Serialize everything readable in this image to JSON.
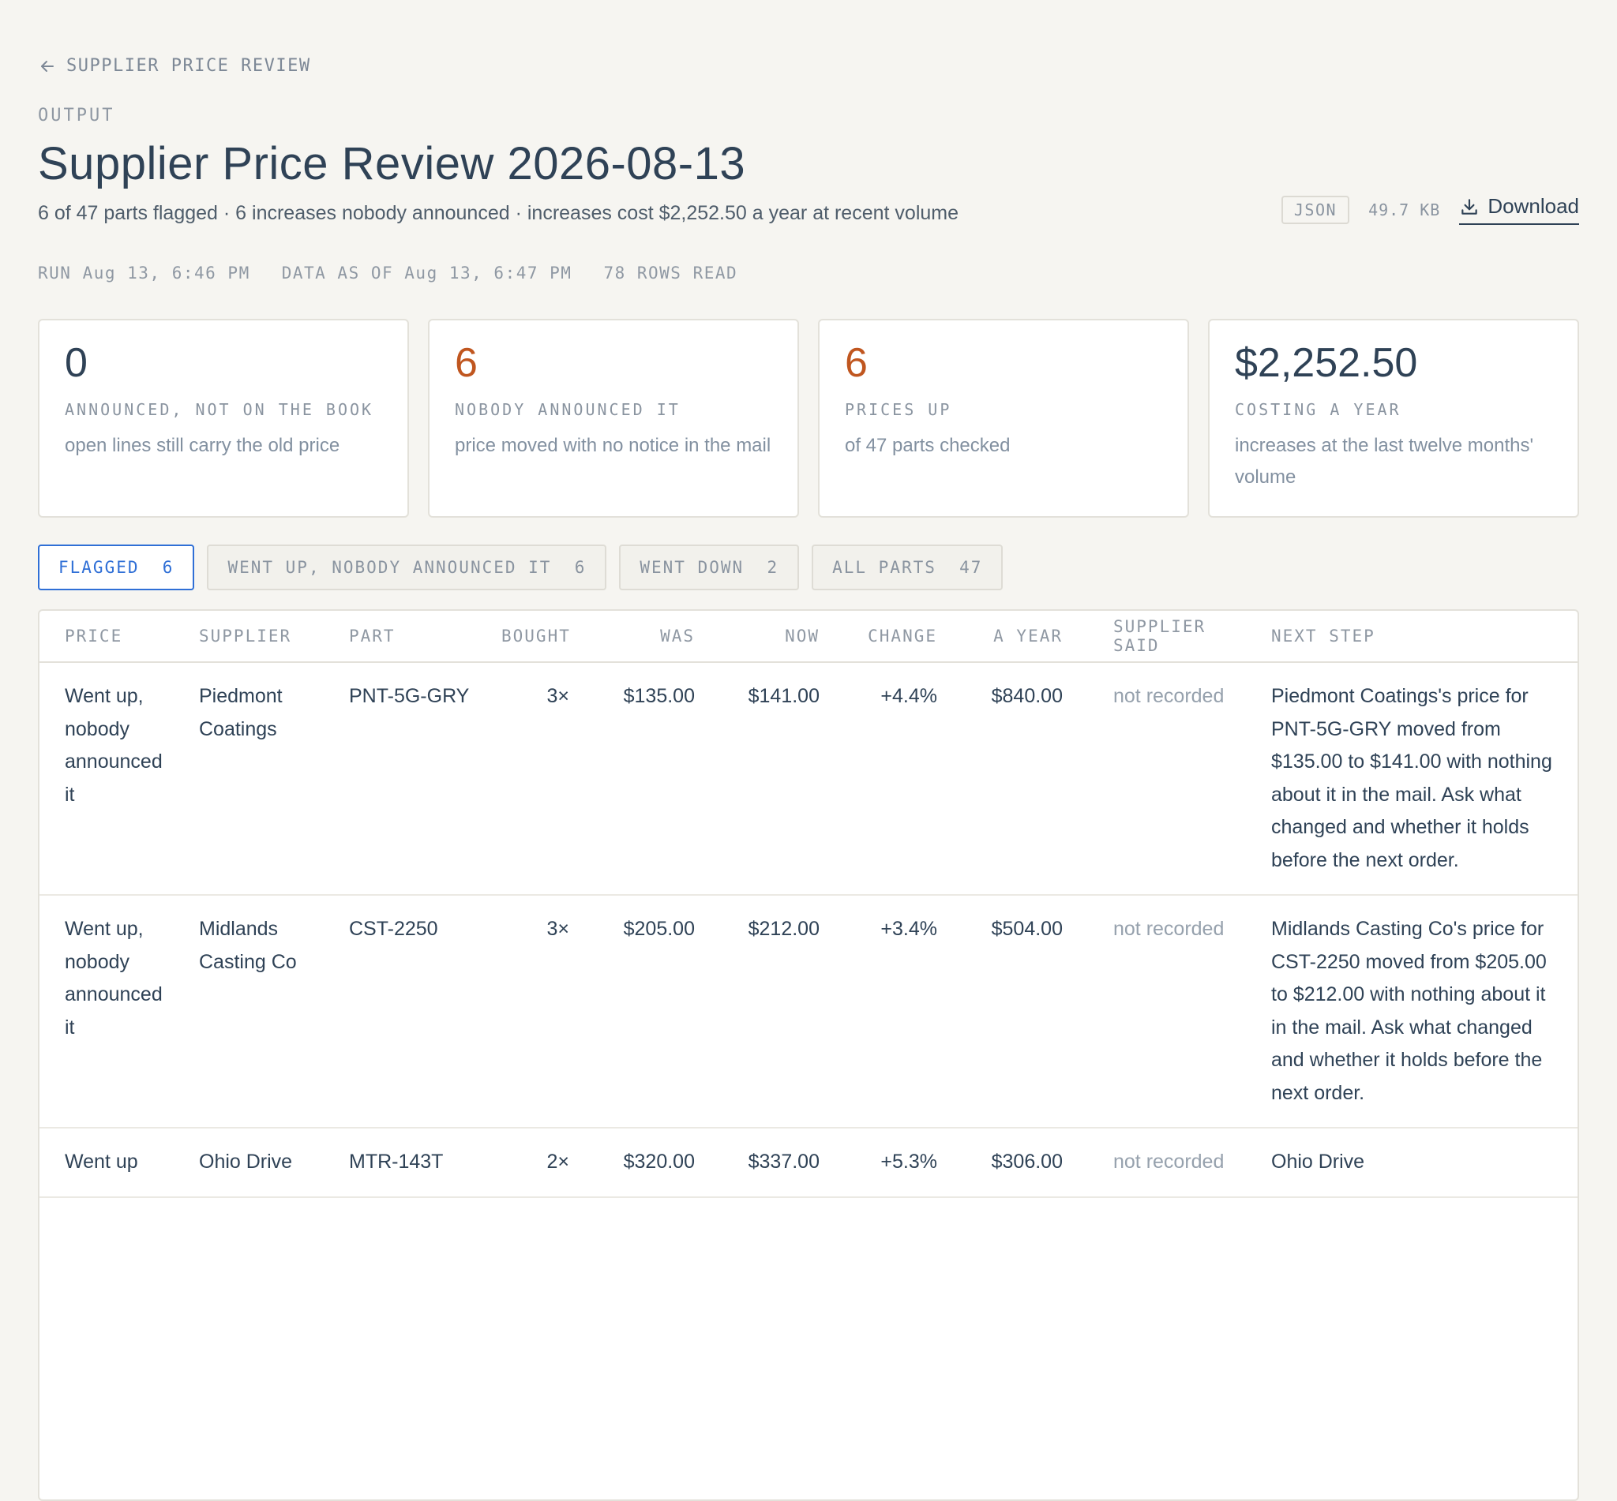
{
  "breadcrumb": {
    "label": "SUPPLIER PRICE REVIEW"
  },
  "page": {
    "eyebrow": "OUTPUT",
    "title": "Supplier Price Review 2026-08-13",
    "summary": "6 of 47 parts flagged · 6 increases nobody announced · increases cost $2,252.50 a year at recent volume"
  },
  "file": {
    "format": "JSON",
    "size": "49.7 KB",
    "download_label": "Download"
  },
  "meta": {
    "run": "RUN Aug 13, 6:46 PM",
    "data_as_of": "DATA AS OF Aug 13, 6:47 PM",
    "rows_read": "78 ROWS READ"
  },
  "cards": [
    {
      "value": "0",
      "label": "ANNOUNCED, NOT ON THE BOOK",
      "desc": "open lines still carry the old price"
    },
    {
      "value": "6",
      "label": "NOBODY ANNOUNCED IT",
      "desc": "price moved with no notice in the mail"
    },
    {
      "value": "6",
      "label": "PRICES UP",
      "desc": "of 47 parts checked"
    },
    {
      "value": "$2,252.50",
      "label": "COSTING A YEAR",
      "desc": "increases at the last twelve months' volume"
    }
  ],
  "colors": {
    "accent": "#2f6fd6",
    "warning": "#c0561f",
    "text": "#2f4256",
    "background": "#f6f5f1"
  },
  "filters": [
    {
      "label": "FLAGGED  6",
      "active": true
    },
    {
      "label": "WENT UP, NOBODY ANNOUNCED IT  6",
      "active": false
    },
    {
      "label": "WENT DOWN  2",
      "active": false
    },
    {
      "label": "ALL PARTS  47",
      "active": false
    }
  ],
  "table": {
    "columns": [
      "PRICE",
      "SUPPLIER",
      "PART",
      "BOUGHT",
      "WAS",
      "NOW",
      "CHANGE",
      "A YEAR",
      "SUPPLIER SAID",
      "NEXT STEP"
    ],
    "rows": [
      {
        "price": "Went up, nobody announced it",
        "supplier": "Piedmont Coatings",
        "part": "PNT-5G-GRY",
        "bought": "3×",
        "was": "$135.00",
        "now": "$141.00",
        "change": "+4.4%",
        "year": "$840.00",
        "said": "not recorded",
        "next": "Piedmont Coatings's price for PNT-5G-GRY moved from $135.00 to $141.00 with nothing about it in the mail. Ask what changed and whether it holds before the next order."
      },
      {
        "price": "Went up, nobody announced it",
        "supplier": "Midlands Casting Co",
        "part": "CST-2250",
        "bought": "3×",
        "was": "$205.00",
        "now": "$212.00",
        "change": "+3.4%",
        "year": "$504.00",
        "said": "not recorded",
        "next": "Midlands Casting Co's price for CST-2250 moved from $205.00 to $212.00 with nothing about it in the mail. Ask what changed and whether it holds before the next order."
      },
      {
        "price": "Went up",
        "supplier": "Ohio Drive",
        "part": "MTR-143T",
        "bought": "2×",
        "was": "$320.00",
        "now": "$337.00",
        "change": "+5.3%",
        "year": "$306.00",
        "said": "not recorded",
        "next": "Ohio Drive"
      }
    ]
  }
}
